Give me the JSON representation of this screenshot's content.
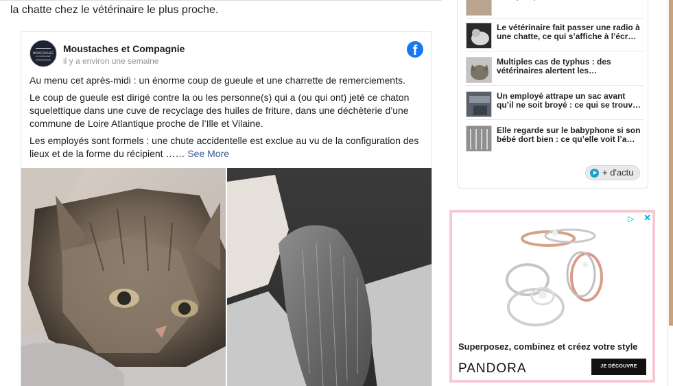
{
  "article": {
    "intro_line": "la chatte chez le vétérinaire le plus proche."
  },
  "fb_post": {
    "page_name": "Moustaches et Compagnie",
    "timestamp": "il y a environ une semaine",
    "avatar_text_1": "MOUSTACHES",
    "avatar_text_2": "et COMPAGNIE",
    "logo_glyph": "f",
    "paragraphs": [
      "Au menu cet après-midi : un énorme coup de gueule et une charrette de remerciements.",
      "Le coup de gueule est dirigé contre la ou les personne(s) qui a (ou qui ont) jeté ce chaton squelettique dans une cuve de recyclage des huiles de friture, dans une déchèterie d’une commune de Loire Atlantique proche de l’Ille et Vilaine.",
      "Les employés sont formels : une chute accidentelle est exclue au vu de la configuration des lieux et de la forme du récipient ……"
    ],
    "see_more": "See More"
  },
  "news": {
    "items": [
      {
        "title": "voit quelque chose se tortiller dans…"
      },
      {
        "title": "Le vétérinaire fait passer une radio à une chatte, ce qui s’affiche à l’écr…"
      },
      {
        "title": "Multiples cas de typhus : des vétérinaires alertent les…"
      },
      {
        "title": "Un employé attrape un sac avant qu’il ne soit broyé : ce qui se trouv…"
      },
      {
        "title": "Elle regarde sur le babyphone si son bébé dort bien : ce qu’elle voit l’a…"
      }
    ],
    "more_label": "+ d'actu"
  },
  "ad": {
    "choices_icon": "▷",
    "close_icon": "✕",
    "tagline": "Superposez, combinez et créez votre style",
    "brand": "PANDORA",
    "cta": "JE DÉCOUVRE"
  },
  "colors": {
    "facebook_blue": "#1877f2",
    "link_blue": "#385898",
    "ad_border": "#f6c8d2",
    "ad_choices": "#00aecd"
  }
}
